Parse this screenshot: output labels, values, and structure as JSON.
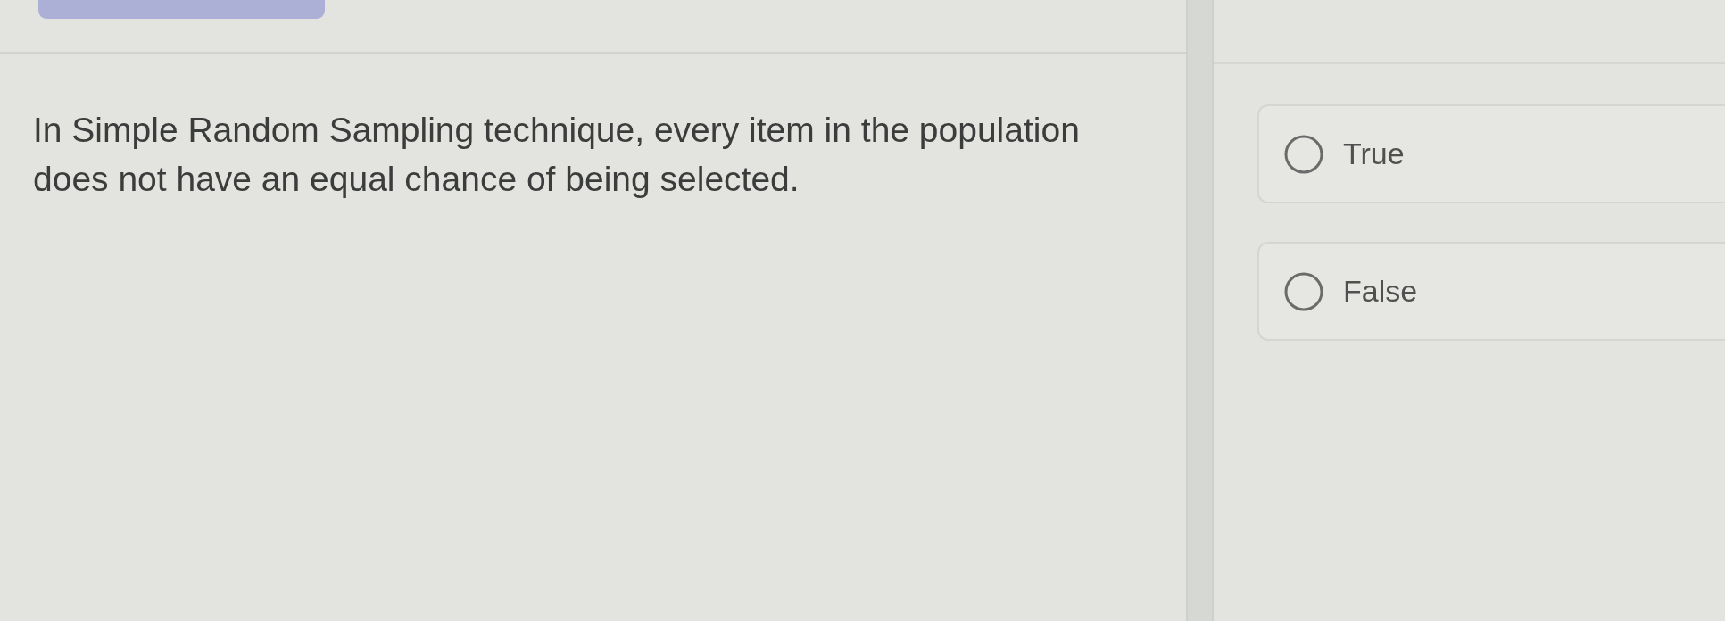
{
  "question": {
    "text": "In Simple Random Sampling technique, every item in the population does not have an equal chance of being selected."
  },
  "answer_choices": [
    {
      "label": "True",
      "selected": false
    },
    {
      "label": "False",
      "selected": false
    }
  ]
}
